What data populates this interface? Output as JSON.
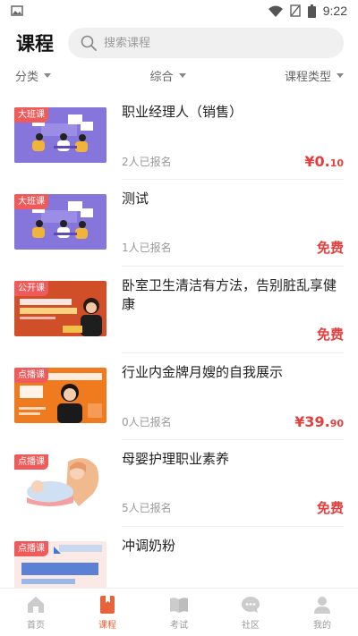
{
  "status": {
    "time": "9:22"
  },
  "header": {
    "title": "课程",
    "search_placeholder": "搜索课程"
  },
  "filters": [
    {
      "label": "分类"
    },
    {
      "label": "综合"
    },
    {
      "label": "课程类型"
    }
  ],
  "courses": [
    {
      "badge": "大班课",
      "title": "职业经理人（销售）",
      "enrolled": "2人已报名",
      "price_main": "¥0.",
      "price_dec": "10",
      "free": false,
      "thumb": "meeting"
    },
    {
      "badge": "大班课",
      "title": "测试",
      "enrolled": "1人已报名",
      "price_text": "免费",
      "free": true,
      "thumb": "meeting"
    },
    {
      "badge": "公开课",
      "title": "卧室卫生清洁有方法，告别脏乱享健康",
      "enrolled": "",
      "price_text": "免费",
      "free": true,
      "thumb": "cleaning"
    },
    {
      "badge": "点播课",
      "title": "行业内金牌月嫂的自我展示",
      "enrolled": "0人已报名",
      "price_main": "¥39.",
      "price_dec": "90",
      "free": false,
      "thumb": "nanny"
    },
    {
      "badge": "点播课",
      "title": "母婴护理职业素养",
      "enrolled": "5人已报名",
      "price_text": "免费",
      "free": true,
      "thumb": "baby"
    },
    {
      "badge": "点播课",
      "title": "冲调奶粉",
      "enrolled": "",
      "price_text": "",
      "free": true,
      "thumb": "milk"
    }
  ],
  "tabbar": [
    {
      "label": "首页",
      "icon": "home-icon",
      "active": false
    },
    {
      "label": "课程",
      "icon": "book-icon",
      "active": true
    },
    {
      "label": "考试",
      "icon": "exam-icon",
      "active": false
    },
    {
      "label": "社区",
      "icon": "chat-icon",
      "active": false
    },
    {
      "label": "我的",
      "icon": "user-icon",
      "active": false
    }
  ],
  "colors": {
    "accent": "#e8633a",
    "price": "#e43e3e",
    "badge": "#ef5a5a"
  }
}
